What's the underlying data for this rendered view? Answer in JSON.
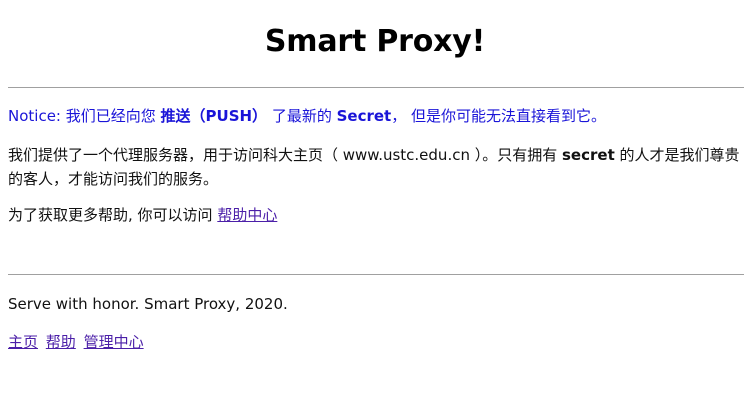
{
  "page": {
    "title": "Smart Proxy!"
  },
  "notice": {
    "prefix": "Notice: 我们已经向您 ",
    "push": "推送（PUSH）",
    "middle": " 了最新的 ",
    "secret": "Secret",
    "suffix": "， 但是你可能无法直接看到它。"
  },
  "intro": {
    "part1": "我们提供了一个代理服务器，用于访问科大主页（ www.ustc.edu.cn ）。只有拥有 ",
    "secret": "secret",
    "part2": " 的人才是我们尊贵的客人，才能访问我们的服务。"
  },
  "help": {
    "text": "为了获取更多帮助, 你可以访问 ",
    "link": "帮助中心"
  },
  "footer": {
    "text": "Serve with honor. Smart Proxy, 2020."
  },
  "links": [
    {
      "label": "主页"
    },
    {
      "label": "帮助"
    },
    {
      "label": "管理中心"
    }
  ],
  "colors": {
    "notice": "#1a14d8",
    "link": "#4b1fa8",
    "rule": "#a0a0a0"
  }
}
